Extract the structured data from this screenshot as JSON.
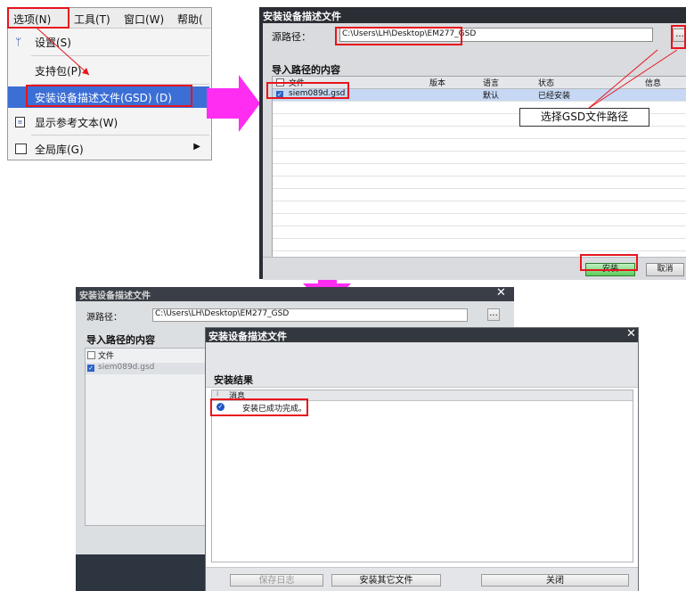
{
  "menu": {
    "bar": [
      "选项(N)",
      "工具(T)",
      "窗口(W)",
      "帮助("
    ],
    "items": [
      {
        "label": "设置(S)",
        "icon": "wrench-icon"
      },
      {
        "label": "支持包(P)",
        "icon": ""
      },
      {
        "label": "安装设备描述文件(GSD) (D)",
        "icon": ""
      },
      {
        "label": "显示参考文本(W)",
        "icon": "document-icon"
      },
      {
        "label": "全局库(G)",
        "icon": "book-icon"
      }
    ]
  },
  "dialog1": {
    "title": "安装设备描述文件",
    "source_label": "源路径：",
    "source_path": "C:\\Users\\LH\\Desktop\\EM277_GSD",
    "browse_label": "...",
    "section_title": "导入路径的内容",
    "columns": [
      "文件",
      "版本",
      "语言",
      "状态",
      "信息"
    ],
    "rows": [
      {
        "file": "siem089d.gsd",
        "version": "",
        "language": "默认",
        "status": "已经安装",
        "info": ""
      }
    ],
    "callout": "选择GSD文件路径",
    "install_button": "安装",
    "cancel_button": "取消"
  },
  "dialog2": {
    "title": "安装设备描述文件",
    "source_label": "源路径：",
    "source_path": "C:\\Users\\LH\\Desktop\\EM277_GSD",
    "section_title": "导入路径的内容",
    "column_file": "文件",
    "row_file": "siem089d.gsd"
  },
  "dialog3": {
    "title": "安装设备描述文件",
    "section_title": "安装结果",
    "column_message": "消息",
    "result_message": "安装已成功完成。",
    "save_log": "保存日志",
    "install_other": "安装其它文件",
    "close": "关闭"
  },
  "colors": {
    "annotation_red": "#e8141c",
    "arrow_magenta": "#ff2cf2",
    "selection_blue": "#3b6cd4",
    "install_green": "#3aa53a"
  }
}
